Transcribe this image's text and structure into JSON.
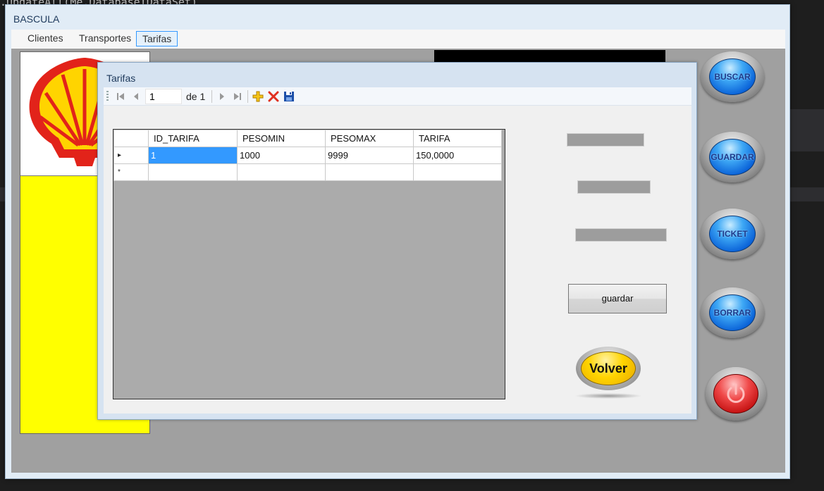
{
  "background": {
    "code_line": ".UpdateAll(Me.DatabaseIDataSet)"
  },
  "window": {
    "title": "BASCULA"
  },
  "menu": {
    "items": [
      "Clientes",
      "Transportes",
      "Tarifas"
    ],
    "active": "Tarifas"
  },
  "side_buttons": {
    "buscar": "BUSCAR",
    "guardar": "GUARDAR",
    "ticket": "TICKET",
    "borrar": "BORRAR"
  },
  "dialog": {
    "title": "Tarifas",
    "navigator": {
      "position": "1",
      "count": "de 1"
    },
    "grid": {
      "columns": [
        "ID_TARIFA",
        "PESOMIN",
        "PESOMAX",
        "TARIFA"
      ],
      "rows": [
        [
          "1",
          "1000",
          "9999",
          "150,0000"
        ]
      ],
      "new_row_marker": "*",
      "current_row_marker": "▸"
    },
    "guardar_label": "guardar",
    "volver_label": "Volver"
  },
  "colors": {
    "accent": "#3399ff",
    "logo_panel": "#ffff00",
    "client_bg": "#a0a0a0",
    "selection": "#3399ff"
  }
}
